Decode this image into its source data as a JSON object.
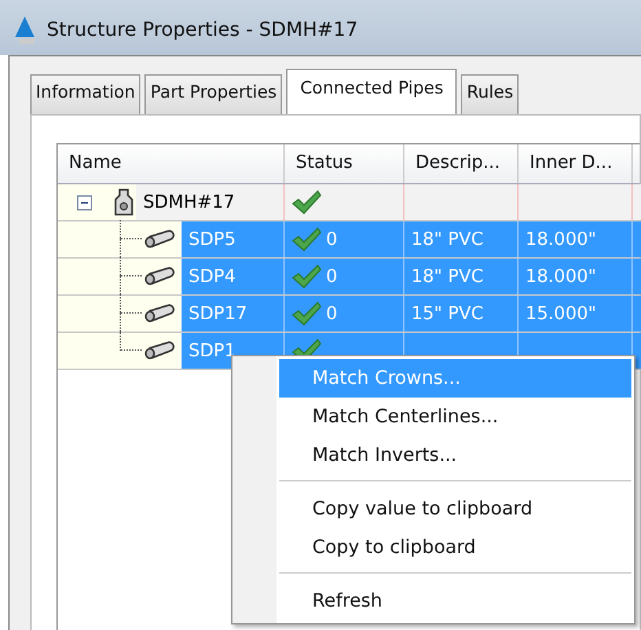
{
  "window": {
    "title": "Structure Properties - SDMH#17"
  },
  "tabs": [
    {
      "label": "Information",
      "selected": false
    },
    {
      "label": "Part Properties",
      "selected": false
    },
    {
      "label": "Connected Pipes",
      "selected": true
    },
    {
      "label": "Rules",
      "selected": false
    }
  ],
  "table": {
    "columns": [
      "Name",
      "Status",
      "Descrip...",
      "Inner D..."
    ],
    "rows": [
      {
        "name": "SDMH#17",
        "kind": "structure",
        "expanded": true,
        "status_ok": true,
        "selected": false,
        "children": [
          {
            "name": "SDP5",
            "kind": "pipe",
            "status_ok": true,
            "count": "0",
            "description": "18\" PVC",
            "inner_diameter": "18.000\"",
            "selected": true
          },
          {
            "name": "SDP4",
            "kind": "pipe",
            "status_ok": true,
            "count": "0",
            "description": "18\" PVC",
            "inner_diameter": "18.000\"",
            "selected": true
          },
          {
            "name": "SDP17",
            "kind": "pipe",
            "status_ok": true,
            "count": "0",
            "description": "15\" PVC",
            "inner_diameter": "15.000\"",
            "selected": true
          },
          {
            "name": "SDP1",
            "kind": "pipe",
            "status_ok": true,
            "selected": true
          }
        ]
      }
    ]
  },
  "context_menu": {
    "groups": [
      [
        {
          "label": "Match Crowns...",
          "selected": true
        },
        {
          "label": "Match Centerlines...",
          "selected": false
        },
        {
          "label": "Match Inverts...",
          "selected": false
        }
      ],
      [
        {
          "label": "Copy value to clipboard",
          "selected": false
        },
        {
          "label": "Copy to clipboard",
          "selected": false
        }
      ],
      [
        {
          "label": "Refresh",
          "selected": false
        }
      ]
    ]
  }
}
